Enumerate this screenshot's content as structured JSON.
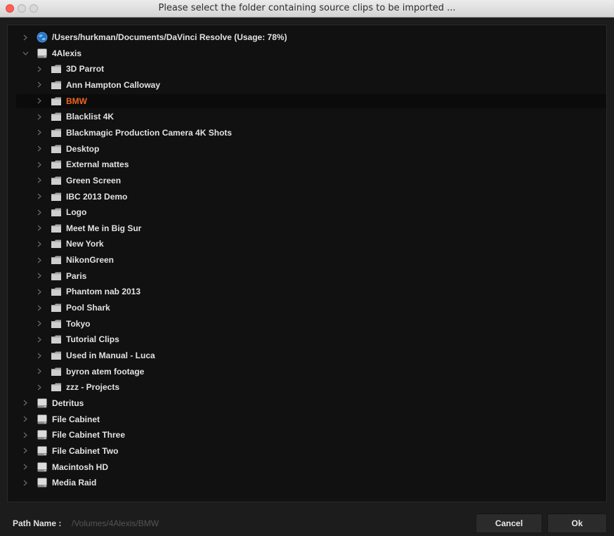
{
  "window": {
    "title": "Please select the folder containing source clips to be imported ..."
  },
  "tree": {
    "items": [
      {
        "label": "/Users/hurkman/Documents/DaVinci Resolve (Usage: 78%)",
        "icon": "globe-icon",
        "level": 0,
        "expanded": false,
        "selected": false
      },
      {
        "label": "4Alexis",
        "icon": "drive-icon",
        "level": 0,
        "expanded": true,
        "selected": false
      },
      {
        "label": "3D Parrot",
        "icon": "folder-icon",
        "level": 1,
        "expanded": false,
        "selected": false
      },
      {
        "label": "Ann Hampton Calloway",
        "icon": "folder-icon",
        "level": 1,
        "expanded": false,
        "selected": false
      },
      {
        "label": "BMW",
        "icon": "folder-icon",
        "level": 1,
        "expanded": false,
        "selected": true
      },
      {
        "label": "Blacklist 4K",
        "icon": "folder-icon",
        "level": 1,
        "expanded": false,
        "selected": false
      },
      {
        "label": "Blackmagic Production Camera 4K Shots",
        "icon": "folder-icon",
        "level": 1,
        "expanded": false,
        "selected": false
      },
      {
        "label": "Desktop",
        "icon": "folder-icon",
        "level": 1,
        "expanded": false,
        "selected": false
      },
      {
        "label": "External mattes",
        "icon": "folder-icon",
        "level": 1,
        "expanded": false,
        "selected": false
      },
      {
        "label": "Green Screen",
        "icon": "folder-icon",
        "level": 1,
        "expanded": false,
        "selected": false
      },
      {
        "label": "IBC 2013 Demo",
        "icon": "folder-icon",
        "level": 1,
        "expanded": false,
        "selected": false
      },
      {
        "label": "Logo",
        "icon": "folder-icon",
        "level": 1,
        "expanded": false,
        "selected": false
      },
      {
        "label": "Meet Me in Big Sur",
        "icon": "folder-icon",
        "level": 1,
        "expanded": false,
        "selected": false
      },
      {
        "label": "New York",
        "icon": "folder-icon",
        "level": 1,
        "expanded": false,
        "selected": false
      },
      {
        "label": "NikonGreen",
        "icon": "folder-icon",
        "level": 1,
        "expanded": false,
        "selected": false
      },
      {
        "label": "Paris",
        "icon": "folder-icon",
        "level": 1,
        "expanded": false,
        "selected": false
      },
      {
        "label": "Phantom nab 2013",
        "icon": "folder-icon",
        "level": 1,
        "expanded": false,
        "selected": false
      },
      {
        "label": "Pool Shark",
        "icon": "folder-icon",
        "level": 1,
        "expanded": false,
        "selected": false
      },
      {
        "label": "Tokyo",
        "icon": "folder-icon",
        "level": 1,
        "expanded": false,
        "selected": false
      },
      {
        "label": "Tutorial Clips",
        "icon": "folder-icon",
        "level": 1,
        "expanded": false,
        "selected": false
      },
      {
        "label": "Used in Manual - Luca",
        "icon": "folder-icon",
        "level": 1,
        "expanded": false,
        "selected": false
      },
      {
        "label": "byron atem footage",
        "icon": "folder-icon",
        "level": 1,
        "expanded": false,
        "selected": false
      },
      {
        "label": "zzz - Projects",
        "icon": "folder-icon",
        "level": 1,
        "expanded": false,
        "selected": false
      },
      {
        "label": "Detritus",
        "icon": "drive-icon",
        "level": 0,
        "expanded": false,
        "selected": false
      },
      {
        "label": "File Cabinet",
        "icon": "drive-icon",
        "level": 0,
        "expanded": false,
        "selected": false
      },
      {
        "label": "File Cabinet Three",
        "icon": "drive-icon",
        "level": 0,
        "expanded": false,
        "selected": false
      },
      {
        "label": "File Cabinet Two",
        "icon": "drive-icon",
        "level": 0,
        "expanded": false,
        "selected": false
      },
      {
        "label": "Macintosh HD",
        "icon": "drive-icon",
        "level": 0,
        "expanded": false,
        "selected": false
      },
      {
        "label": "Media Raid",
        "icon": "drive-icon",
        "level": 0,
        "expanded": false,
        "selected": false
      }
    ]
  },
  "footer": {
    "path_label": "Path Name :",
    "path_value": "/Volumes/4Alexis/BMW",
    "cancel_label": "Cancel",
    "ok_label": "Ok"
  },
  "colors": {
    "selected_text": "#f0651e",
    "background": "#111111"
  }
}
